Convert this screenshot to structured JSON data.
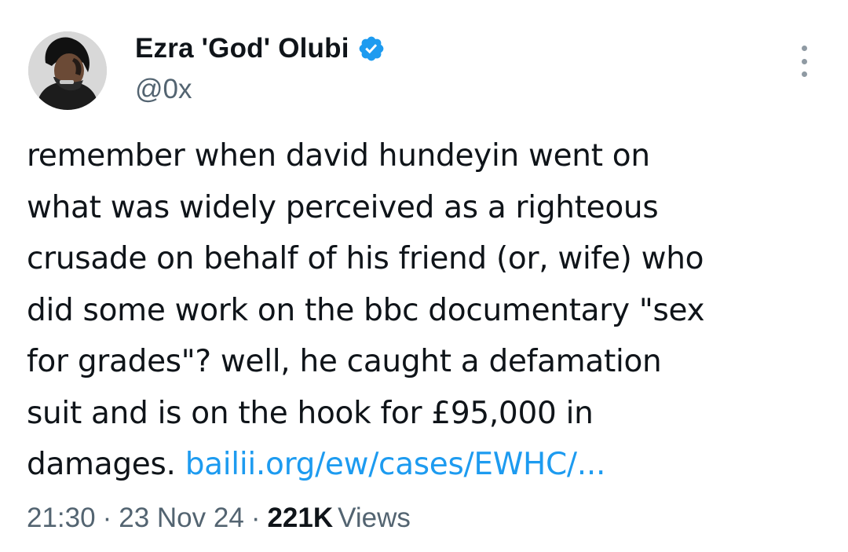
{
  "user": {
    "display_name": "Ezra 'God' Olubi",
    "handle": "@0x",
    "verified": true
  },
  "tweet": {
    "lines": [
      "remember when david hundeyin went on",
      "what was widely perceived as a righteous",
      "crusade on behalf of his friend (or, wife) who",
      "did some work on the bbc documentary \"sex",
      "for grades\"? well, he caught a defamation",
      "suit and is on the hook for £95,000 in"
    ],
    "last_line_text": "damages. ",
    "link_text": "bailii.org/ew/cases/EWHC/..."
  },
  "meta": {
    "time": "21:30",
    "date": "23 Nov 24",
    "views_count": "221K",
    "views_label": "Views",
    "separator": "·"
  },
  "colors": {
    "text": "#0f1419",
    "secondary": "#536471",
    "link": "#1d9bf0",
    "verified": "#1d9bf0"
  },
  "icons": {
    "verified": "verified-badge-icon",
    "more": "more-options-icon"
  }
}
